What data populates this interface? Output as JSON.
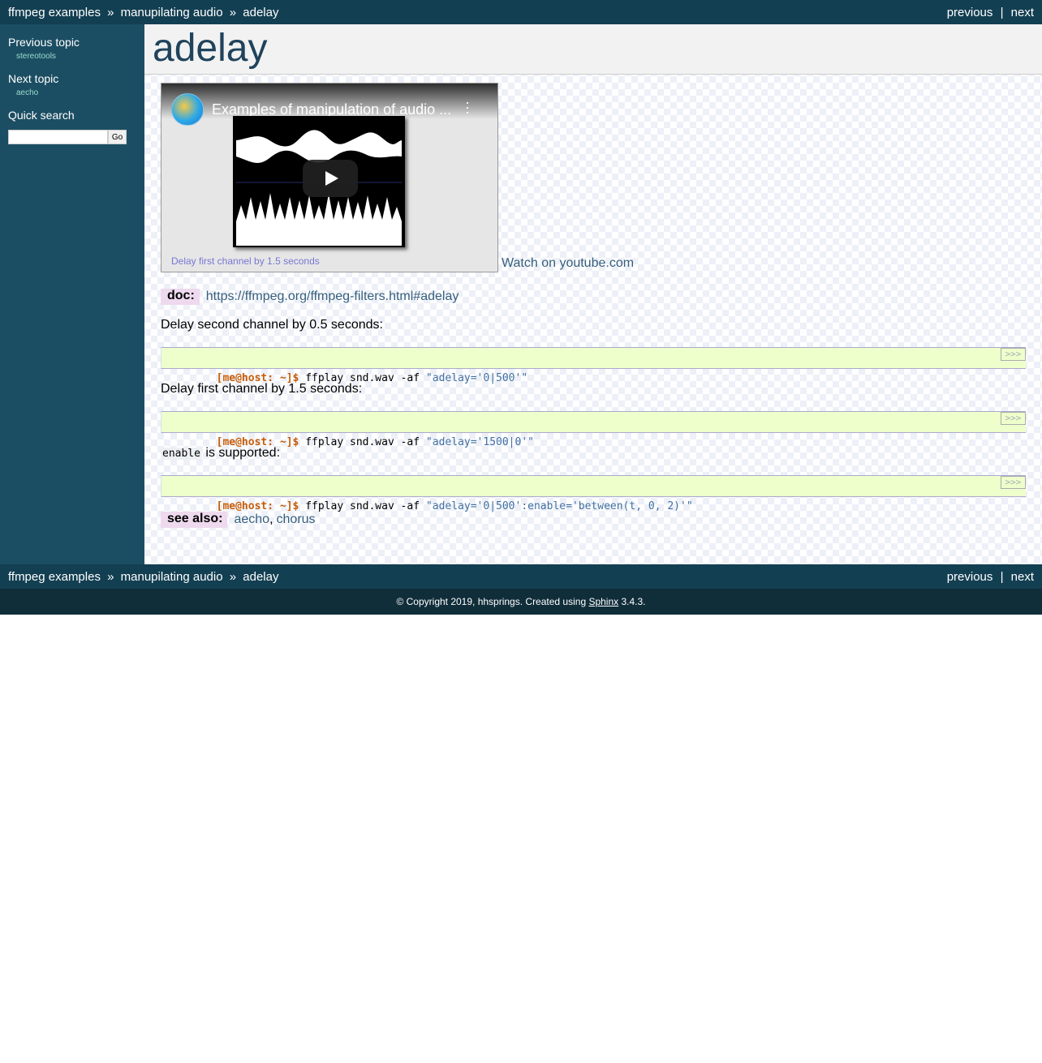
{
  "nav": {
    "crumb1": "ffmpeg examples",
    "sep": "»",
    "crumb2": "manupilating audio",
    "crumb3": "adelay",
    "previous": "previous",
    "pipe": "|",
    "next": "next"
  },
  "sidebar": {
    "prev_heading": "Previous topic",
    "prev_link": "stereotools",
    "next_heading": "Next topic",
    "next_link": "aecho",
    "search_heading": "Quick search",
    "search_value": "",
    "go_label": "Go"
  },
  "page": {
    "title": "adelay",
    "video_title": "Examples of manipulation of audio ...",
    "video_blurb": "Delay first channel by 1.5 seconds",
    "watch_link": "Watch on youtube.com",
    "doc_label": "doc:",
    "doc_link": "https://ffmpeg.org/ffmpeg-filters.html#adelay",
    "text1": "Delay second channel by 0.5 seconds:",
    "text2": "Delay first channel by 1.5 seconds:",
    "text3_code": "enable",
    "text3_rest": " is supported:",
    "see_also_label": "see also:",
    "see_also_1": "aecho",
    "comma": ",",
    "see_also_2": "chorus"
  },
  "code_blocks": [
    {
      "prompt": "[me@host: ~]$",
      "cmd": " ffplay snd.wav -af ",
      "str": "\"adelay='0|500'\"",
      "copy": ">>>"
    },
    {
      "prompt": "[me@host: ~]$",
      "cmd": " ffplay snd.wav -af ",
      "str": "\"adelay='1500|0'\"",
      "copy": ">>>"
    },
    {
      "prompt": "[me@host: ~]$",
      "cmd": " ffplay snd.wav -af ",
      "str": "\"adelay='0|500':enable='between(t, 0, 2)'\"",
      "copy": ">>>"
    }
  ],
  "footer": {
    "copyright_prefix": "© Copyright 2019, hhsprings. Created using ",
    "sphinx": "Sphinx",
    "version": " 3.4.3."
  },
  "colors": {
    "relbar": "#133f52",
    "sidebar": "#1c4e63",
    "title": "#20435c",
    "link": "#355f7c",
    "code_bg": "#eeffcc",
    "prompt": "#c65d09",
    "string": "#4070a0",
    "field_label_bg": "#eed9ee"
  }
}
